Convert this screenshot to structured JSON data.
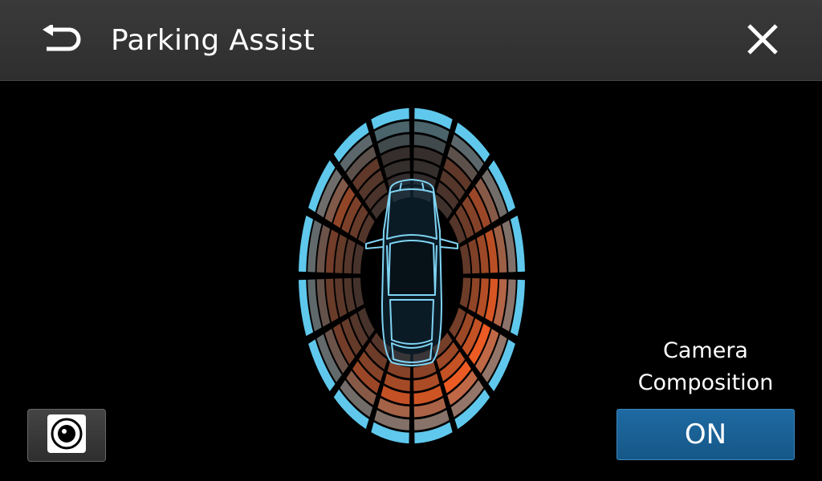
{
  "header": {
    "title": "Parking Assist",
    "back_icon": "back-arrow-icon",
    "close_icon": "close-icon"
  },
  "sensor_view": {
    "car_icon": "car-top-view-icon",
    "zones": [
      "front",
      "front-right",
      "right",
      "rear-right",
      "rear",
      "rear-left",
      "left",
      "front-left"
    ]
  },
  "camera_button": {
    "icon": "camera-icon"
  },
  "camera_composition": {
    "label_line1": "Camera",
    "label_line2": "Composition",
    "toggle_label": "ON"
  },
  "colors": {
    "header_bg": "#333333",
    "accent_blue": "#1e6aa3",
    "sensor_cyan": "#5fc8ec",
    "sensor_orange": "#ff5a1f",
    "car_outline": "#7fd4f4"
  }
}
